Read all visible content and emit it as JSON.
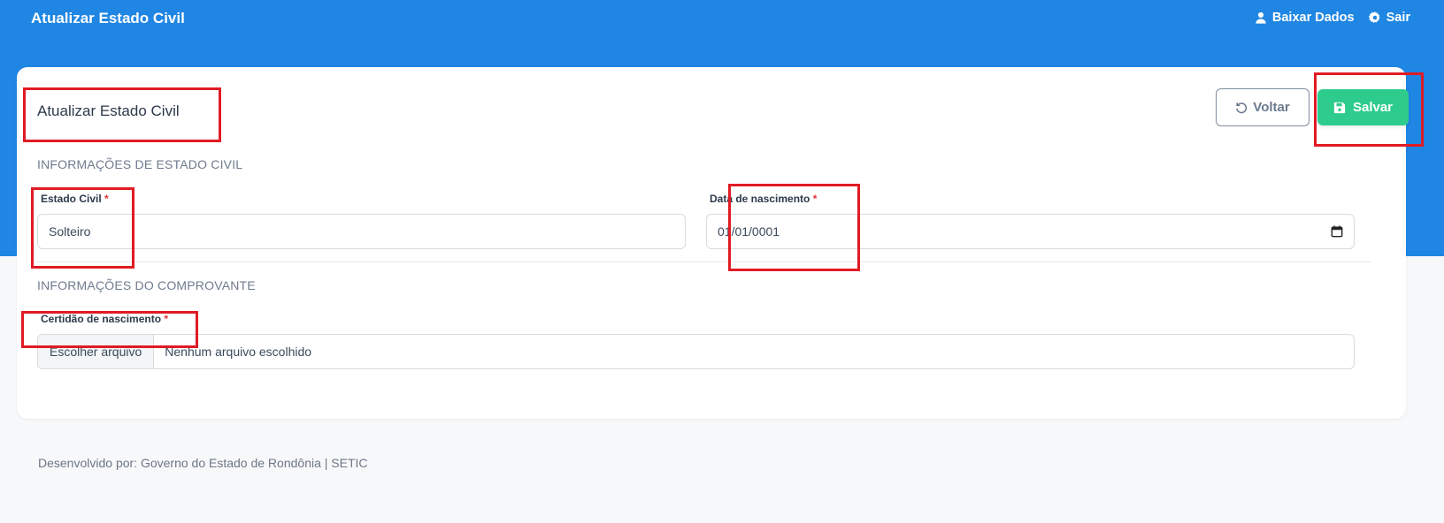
{
  "header": {
    "title": "Atualizar Estado Civil",
    "actions": [
      {
        "label": "Baixar Dados",
        "icon": "user-icon"
      },
      {
        "label": "Sair",
        "icon": "gear-icon"
      }
    ]
  },
  "card": {
    "title": "Atualizar Estado Civil",
    "buttons": {
      "back_label": "Voltar",
      "save_label": "Salvar"
    },
    "section_estado": {
      "title": "INFORMAÇÕES DE ESTADO CIVIL",
      "estado_civil": {
        "label": "Estado Civil",
        "required": "*",
        "value": "Solteiro"
      },
      "data_nascimento": {
        "label": "Data de nascimento",
        "required": "*",
        "value": "01/01/0001"
      }
    },
    "section_comprovante": {
      "title": "INFORMAÇÕES DO COMPROVANTE",
      "certidao": {
        "label": "Certidão de nascimento",
        "required": "*",
        "button_label": "Escolher arquivo",
        "file_status": "Nenhum arquivo escolhido"
      }
    }
  },
  "footer": {
    "text": "Desenvolvido por: Governo do Estado de Rondônia | SETIC"
  },
  "colors": {
    "header_bg": "#1f86e3",
    "save_button": "#2ecc8c",
    "required_mark": "#e03131",
    "highlight_box": "#e01b24"
  }
}
